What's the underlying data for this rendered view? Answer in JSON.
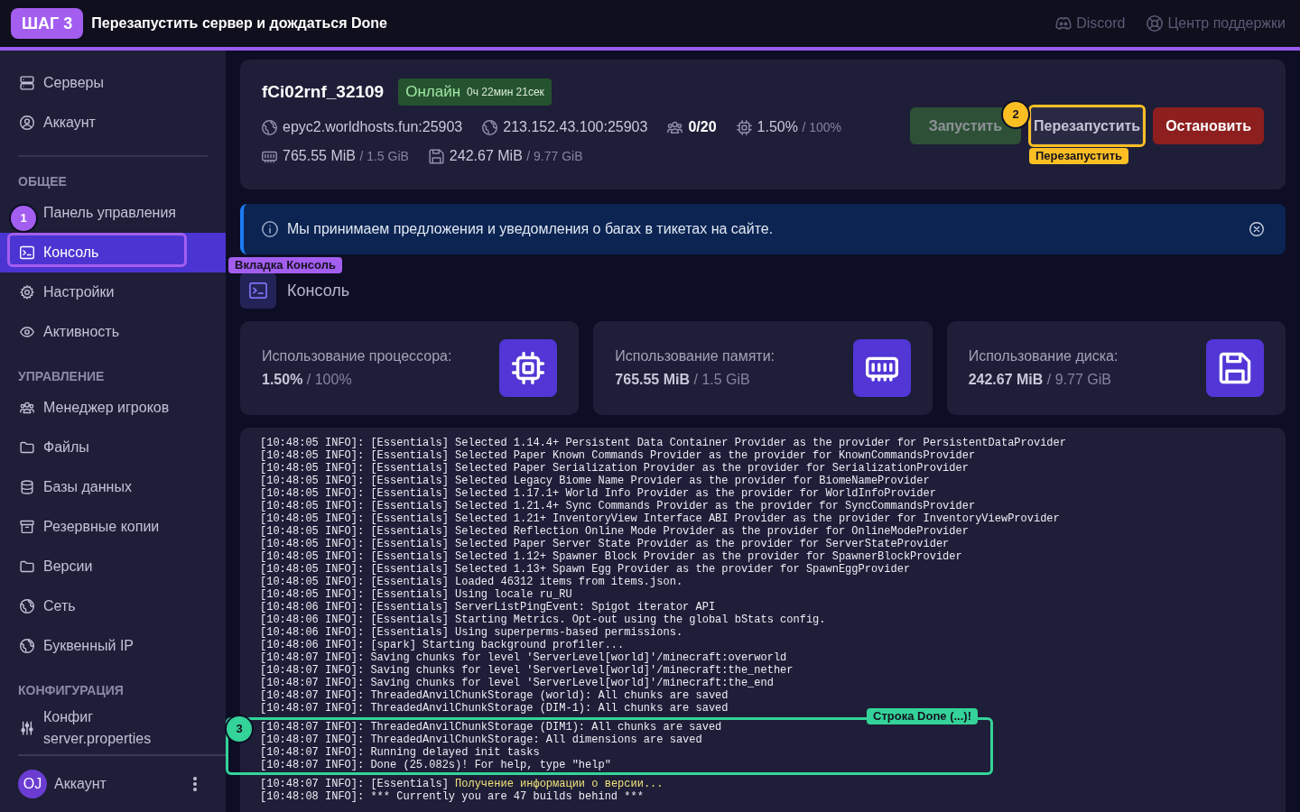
{
  "step": {
    "badge": "ШАГ 3",
    "title": "Перезапустить сервер и дождаться Done"
  },
  "topbar": {
    "links": [
      "Discord",
      "Центр поддержки"
    ]
  },
  "sidebar": {
    "groups": [
      {
        "items": [
          {
            "label": "Серверы",
            "selected": false
          },
          {
            "label": "Аккаунт",
            "selected": false
          }
        ]
      },
      {
        "title": "ОБЩЕЕ",
        "items": [
          {
            "label": "Панель управления",
            "selected": false
          },
          {
            "label": "Консоль",
            "selected": true,
            "callout": {
              "number": "1",
              "label": "Вкладка Консоль",
              "color": "#a35ef0"
            }
          },
          {
            "label": "Настройки",
            "selected": false
          },
          {
            "label": "Активность",
            "selected": false
          }
        ]
      },
      {
        "title": "УПРАВЛЕНИЕ",
        "items": [
          {
            "label": "Менеджер игроков",
            "selected": false
          },
          {
            "label": "Файлы",
            "selected": false
          },
          {
            "label": "Базы данных",
            "selected": false
          },
          {
            "label": "Резервные копии",
            "selected": false
          },
          {
            "label": "Версии",
            "selected": false
          },
          {
            "label": "Сеть",
            "selected": false
          },
          {
            "label": "Буквенный IP",
            "selected": false
          }
        ]
      },
      {
        "title": "КОНФИГУРАЦИЯ",
        "items": [
          {
            "label": "Конфиг server.properties",
            "selected": false
          }
        ]
      }
    ],
    "account": {
      "initials": "OJ",
      "label": "Аккаунт"
    }
  },
  "server": {
    "name": "fCi02rnf_32109",
    "status": {
      "kind": "online",
      "label": "Онлайн",
      "uptime": "0ч 22мин 21сек"
    },
    "details": [
      [
        {
          "kind": "address",
          "value": "epyc2.worldhosts.fun:25903"
        },
        {
          "kind": "address",
          "value": "213.152.43.100:25903"
        },
        {
          "kind": "count",
          "value": "0/20"
        },
        {
          "kind": "usage",
          "value": "1.50%",
          "limit": "/ 100%"
        }
      ],
      [
        {
          "kind": "usage",
          "value": "765.55 MiB",
          "limit": "/ 1.5 GiB"
        },
        {
          "kind": "usage",
          "value": "242.67 MiB",
          "limit": "/ 9.77 GiB"
        }
      ]
    ],
    "buttons": [
      {
        "kind": "start",
        "label": "Запустить",
        "disabled": true
      },
      {
        "kind": "restart",
        "label": "Перезапустить",
        "disabled": false,
        "callout": {
          "number": "2",
          "label": "Перезапустить",
          "color": "#fbbf24"
        }
      },
      {
        "kind": "stop",
        "label": "Остановить",
        "disabled": false
      }
    ]
  },
  "alert": {
    "text": "Мы принимаем предложения и уведомления о багах в тикетах на сайте."
  },
  "section": {
    "title": "Консоль"
  },
  "stats": [
    {
      "label": "Использование процессора:",
      "value": "1.50%",
      "limit": "/ 100%"
    },
    {
      "label": "Использование памяти:",
      "value": "765.55 MiB",
      "limit": "/ 1.5 GiB"
    },
    {
      "label": "Использование диска:",
      "value": "242.67 MiB",
      "limit": "/ 9.77 GiB"
    }
  ],
  "console": {
    "blocks": [
      {
        "lines": [
          {
            "text": "[10:48:05 INFO]: [Essentials] Selected 1.14.4+ Persistent Data Container Provider as the provider for PersistentDataProvider"
          },
          {
            "text": "[10:48:05 INFO]: [Essentials] Selected Paper Known Commands Provider as the provider for KnownCommandsProvider"
          },
          {
            "text": "[10:48:05 INFO]: [Essentials] Selected Paper Serialization Provider as the provider for SerializationProvider"
          },
          {
            "text": "[10:48:05 INFO]: [Essentials] Selected Legacy Biome Name Provider as the provider for BiomeNameProvider"
          },
          {
            "text": "[10:48:05 INFO]: [Essentials] Selected 1.17.1+ World Info Provider as the provider for WorldInfoProvider"
          },
          {
            "text": "[10:48:05 INFO]: [Essentials] Selected 1.21.4+ Sync Commands Provider as the provider for SyncCommandsProvider"
          },
          {
            "text": "[10:48:05 INFO]: [Essentials] Selected 1.21+ InventoryView Interface ABI Provider as the provider for InventoryViewProvider"
          },
          {
            "text": "[10:48:05 INFO]: [Essentials] Selected Reflection Online Mode Provider as the provider for OnlineModeProvider"
          },
          {
            "text": "[10:48:05 INFO]: [Essentials] Selected Paper Server State Provider as the provider for ServerStateProvider"
          },
          {
            "text": "[10:48:05 INFO]: [Essentials] Selected 1.12+ Spawner Block Provider as the provider for SpawnerBlockProvider"
          },
          {
            "text": "[10:48:05 INFO]: [Essentials] Selected 1.13+ Spawn Egg Provider as the provider for SpawnEggProvider"
          },
          {
            "text": "[10:48:05 INFO]: [Essentials] Loaded 46312 items from items.json."
          },
          {
            "text": "[10:48:05 INFO]: [Essentials] Using locale ru_RU"
          },
          {
            "text": "[10:48:06 INFO]: [Essentials] ServerListPingEvent: Spigot iterator API"
          },
          {
            "text": "[10:48:06 INFO]: [Essentials] Starting Metrics. Opt-out using the global bStats config."
          },
          {
            "text": "[10:48:06 INFO]: [Essentials] Using superperms-based permissions."
          },
          {
            "text": "[10:48:06 INFO]: [spark] Starting background profiler..."
          },
          {
            "text": "[10:48:07 INFO]: Saving chunks for level 'ServerLevel[world]'/minecraft:overworld"
          },
          {
            "text": "[10:48:07 INFO]: Saving chunks for level 'ServerLevel[world]'/minecraft:the_nether"
          },
          {
            "text": "[10:48:07 INFO]: Saving chunks for level 'ServerLevel[world]'/minecraft:the_end"
          },
          {
            "text": "[10:48:07 INFO]: ThreadedAnvilChunkStorage (world): All chunks are saved"
          },
          {
            "text": "[10:48:07 INFO]: ThreadedAnvilChunkStorage (DIM-1): All chunks are saved"
          }
        ]
      },
      {
        "callout": {
          "number": "3",
          "label": "Строка Done (...)!",
          "color": "#34d399"
        },
        "lines": [
          {
            "text": "[10:48:07 INFO]: ThreadedAnvilChunkStorage (DIM1): All chunks are saved"
          },
          {
            "text": "[10:48:07 INFO]: ThreadedAnvilChunkStorage: All dimensions are saved"
          },
          {
            "text": "[10:48:07 INFO]: Running delayed init tasks"
          },
          {
            "text": "[10:48:07 INFO]: Done (25.082s)! For help, type \"help\""
          }
        ]
      },
      {
        "lines": [
          {
            "text": "[10:48:07 INFO]: [Essentials]",
            "notice": "Получение информации о версии..."
          },
          {
            "text": "[10:48:08 INFO]: *** Currently you are 47 builds behind ***"
          }
        ]
      }
    ]
  }
}
